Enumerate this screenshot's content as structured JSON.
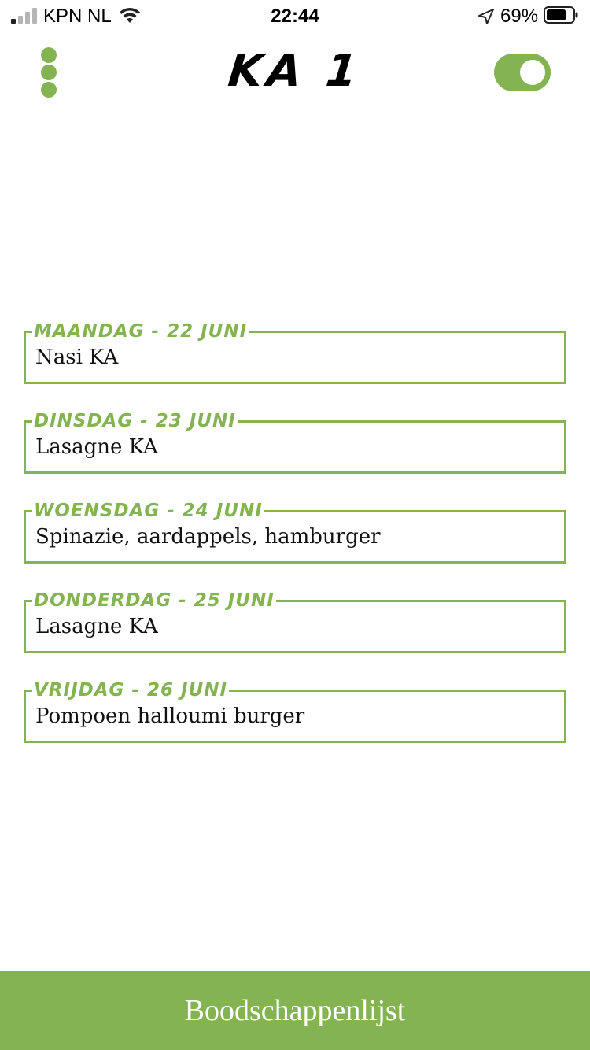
{
  "status_bar": {
    "carrier": "KPN NL",
    "time": "22:44",
    "battery_percent": "69%",
    "signal_bars_active": 1,
    "icons": [
      "signal-icon",
      "wifi-icon",
      "location-arrow-icon",
      "battery-icon"
    ]
  },
  "header": {
    "title": "KA 1",
    "menu_icon": "vertical-dots-icon",
    "toggle_on": true
  },
  "days": [
    {
      "label": "Maandag - 22 juni",
      "meal": "Nasi KA"
    },
    {
      "label": "Dinsdag - 23 juni",
      "meal": "Lasagne KA"
    },
    {
      "label": "Woensdag - 24 juni",
      "meal": "Spinazie, aardappels, hamburger"
    },
    {
      "label": "Donderdag - 25 juni",
      "meal": "Lasagne KA"
    },
    {
      "label": "Vrijdag - 26 juni",
      "meal": "Pompoen halloumi burger"
    }
  ],
  "bottom_button": {
    "label": "Boodschappenlijst"
  },
  "colors": {
    "accent": "#84b451",
    "background": "#ffffff",
    "text": "#111111"
  }
}
